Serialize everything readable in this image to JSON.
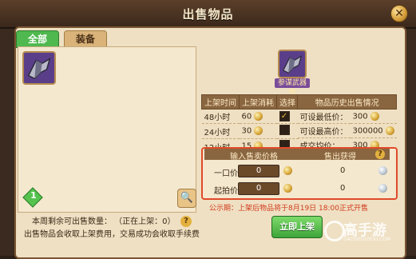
{
  "window": {
    "title": "出售物品",
    "close_label": "✕"
  },
  "tabs": [
    {
      "label": "全部",
      "active": true
    },
    {
      "label": "装备",
      "active": false
    }
  ],
  "left": {
    "gem_count": "1",
    "remain_line": "本周剩余可出售数量：    （正在上架：0）",
    "fee_line": "出售物品会收取上架费用，交易成功会收取手续费"
  },
  "item": {
    "name": "参谋武器甲"
  },
  "listing_table": {
    "headers": [
      "上架时间",
      "上架消耗",
      "选择"
    ],
    "rows": [
      {
        "time": "48小时",
        "cost": "60",
        "selected": true
      },
      {
        "time": "24小时",
        "cost": "30",
        "selected": false
      },
      {
        "time": "12小时",
        "cost": "15",
        "selected": false
      }
    ]
  },
  "history_table": {
    "header": "物品历史出售情况",
    "rows": [
      {
        "label": "可设最低价：",
        "value": "300"
      },
      {
        "label": "可设最高价：",
        "value": "300000"
      },
      {
        "label": "成交均价：",
        "value": "300"
      }
    ]
  },
  "sell": {
    "header_input": "输入售卖价格",
    "header_income": "售出获得",
    "buyout_label": "一口价",
    "buyout_value": "0",
    "buyout_income": "0",
    "start_label": "起拍价",
    "start_value": "0",
    "start_income": "0"
  },
  "notice": "公示期：上架后物品将于8月19日 18:00正式开售",
  "submit_label": "立即上架",
  "watermark": {
    "text": "高手游",
    "sub": "GAOSHOUYOU.COM"
  }
}
